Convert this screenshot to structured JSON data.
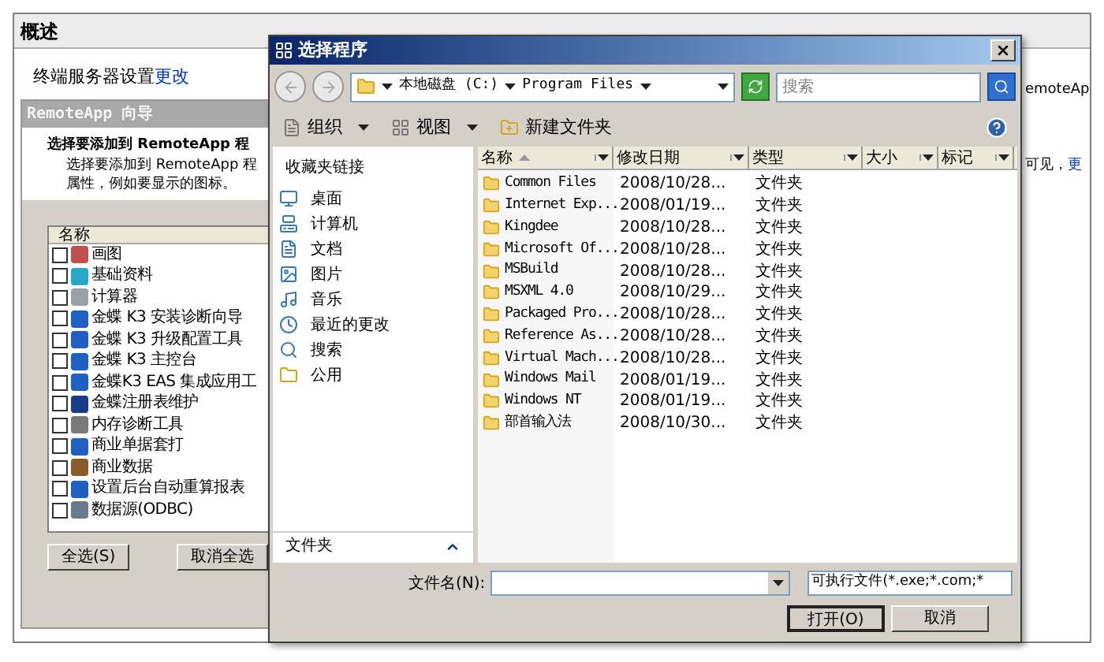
{
  "background_window": {
    "title": "概述",
    "settings_text": "终端服务器设置",
    "settings_link": "更改",
    "wizard": {
      "title": "RemoteApp 向导",
      "heading": "选择要添加到 RemoteApp 程",
      "description": [
        "选择要添加到 RemoteApp 程",
        "属性，例如要显示的图标。"
      ],
      "list_header": "名称",
      "programs": [
        {
          "name": "画图",
          "checked": false
        },
        {
          "name": "基础资料",
          "checked": false
        },
        {
          "name": "计算器",
          "checked": false
        },
        {
          "name": "金蝶 K3 安装诊断向导",
          "checked": false
        },
        {
          "name": "金蝶 K3 升级配置工具",
          "checked": false
        },
        {
          "name": "金蝶 K3 主控台",
          "checked": false
        },
        {
          "name": "金蝶K3 EAS 集成应用工",
          "checked": false
        },
        {
          "name": "金蝶注册表维护",
          "checked": false
        },
        {
          "name": "内存诊断工具",
          "checked": false
        },
        {
          "name": "商业单据套打",
          "checked": false
        },
        {
          "name": "商业数据",
          "checked": false
        },
        {
          "name": "设置后台自动重算报表",
          "checked": false
        },
        {
          "name": "数据源(ODBC)",
          "checked": false
        }
      ],
      "buttons": [
        "全选(S)",
        "取消全选"
      ]
    },
    "actions_pane": {
      "line_1": "emoteAp",
      "line_2": "可见，",
      "link": "更"
    }
  },
  "dialog": {
    "title": "选择程序",
    "address": [
      "本地磁盘 (C:)",
      "Program Files"
    ],
    "search": {
      "placeholder": "搜索"
    },
    "toolbar": [
      {
        "label": "组织",
        "dropdown": true
      },
      {
        "label": "视图",
        "dropdown": true
      },
      {
        "label": "新建文件夹",
        "dropdown": false
      }
    ],
    "favorites": {
      "title": "收藏夹链接",
      "items": [
        "桌面",
        "计算机",
        "文档",
        "图片",
        "音乐",
        "最近的更改",
        "搜索",
        "公用"
      ]
    },
    "folders_label": "文件夹",
    "columns": [
      {
        "label": "名称",
        "sorted": true
      },
      {
        "label": "修改日期",
        "sorted": false
      },
      {
        "label": "类型",
        "sorted": false
      },
      {
        "label": "大小",
        "sorted": false
      },
      {
        "label": "标记",
        "sorted": false
      }
    ],
    "files": [
      {
        "name": "Common Files",
        "modified": "2008/10/28...",
        "type": "文件夹"
      },
      {
        "name": "Internet Exp...",
        "modified": "2008/01/19...",
        "type": "文件夹"
      },
      {
        "name": "Kingdee",
        "modified": "2008/10/28...",
        "type": "文件夹"
      },
      {
        "name": "Microsoft Of...",
        "modified": "2008/10/28...",
        "type": "文件夹"
      },
      {
        "name": "MSBuild",
        "modified": "2008/10/28...",
        "type": "文件夹"
      },
      {
        "name": "MSXML 4.0",
        "modified": "2008/10/29...",
        "type": "文件夹"
      },
      {
        "name": "Packaged Pro...",
        "modified": "2008/10/28...",
        "type": "文件夹"
      },
      {
        "name": "Reference As...",
        "modified": "2008/10/28...",
        "type": "文件夹"
      },
      {
        "name": "Virtual Mach...",
        "modified": "2008/10/28...",
        "type": "文件夹"
      },
      {
        "name": "Windows Mail",
        "modified": "2008/01/19...",
        "type": "文件夹"
      },
      {
        "name": "Windows NT",
        "modified": "2008/01/19...",
        "type": "文件夹"
      },
      {
        "name": "部首输入法",
        "modified": "2008/10/30...",
        "type": "文件夹"
      }
    ],
    "file_name_label": "文件名(N):",
    "file_type": "可执行文件(*.exe;*.com;*",
    "buttons": [
      "打开(O)",
      "取消"
    ]
  }
}
